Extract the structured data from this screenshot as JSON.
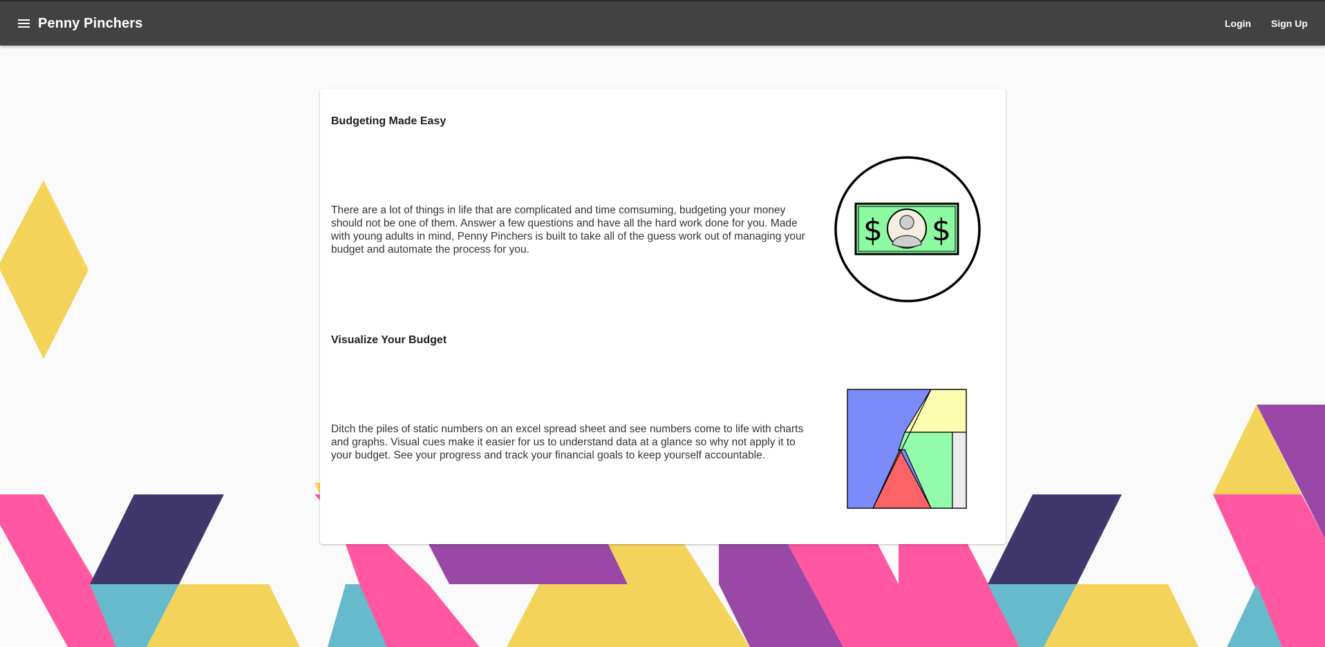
{
  "header": {
    "brand": "Penny Pinchers",
    "login_label": "Login",
    "signup_label": "Sign Up"
  },
  "sections": [
    {
      "title": "Budgeting Made Easy",
      "text": "There are a lot of things in life that are complicated and time comsuming, budgeting your money should not be one of them. Answer a few questions and have all the hard work done for you. Made with young adults in mind, Penny Pinchers is built to take all of the guess work out of managing your budget and automate the process for you.",
      "icon": "money-bill-icon"
    },
    {
      "title": "Visualize Your Budget",
      "text": "Ditch the piles of static numbers on an excel spread sheet and see numbers come to life with charts and graphs. Visual cues make it easier for us to understand data at a glance so why not apply it to your budget. See your progress and track your financial goals to keep yourself accountable.",
      "icon": "budget-chart-icon"
    }
  ],
  "colors": {
    "header_bg": "#424242",
    "page_bg": "#fafafa",
    "pink": "#ff57a1",
    "purple": "#9a48a5",
    "navy": "#40386c",
    "teal": "#67b9cc",
    "yellow": "#f3d35a",
    "bill_green": "#8dfaa2",
    "chart_blue": "#7b8cfa",
    "chart_yellow": "#fdfdb1",
    "chart_green": "#93fcac",
    "chart_red": "#fb6467"
  }
}
